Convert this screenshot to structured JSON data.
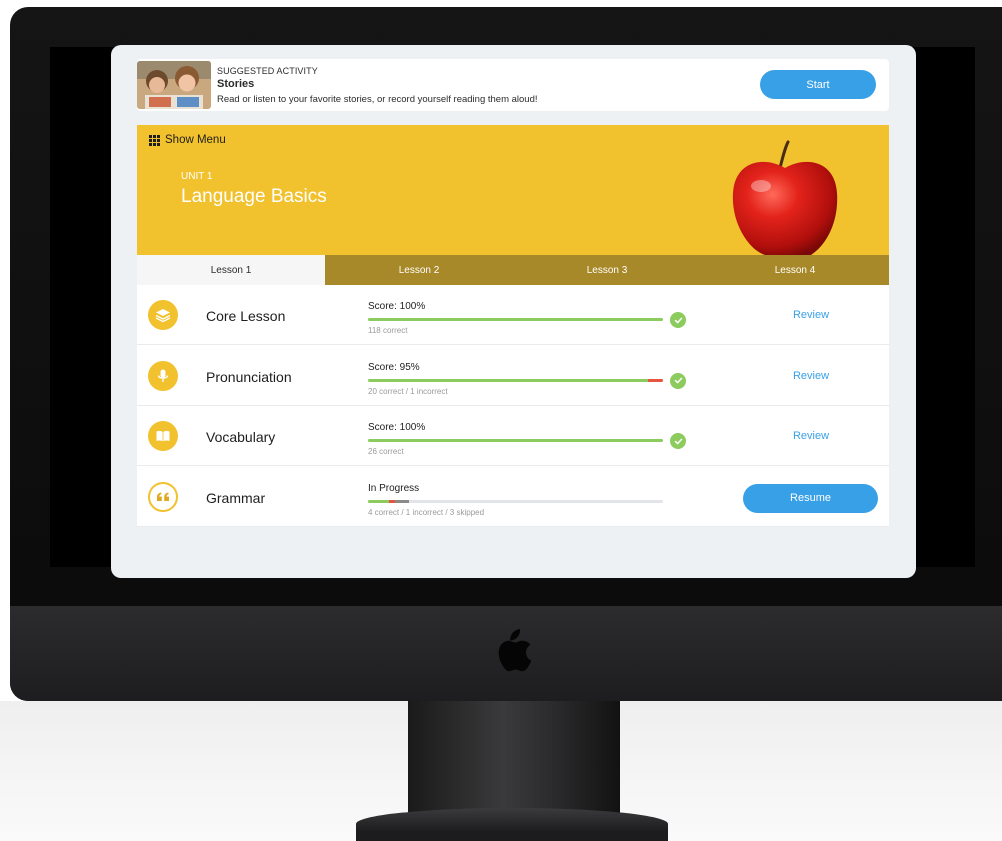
{
  "suggested": {
    "kicker": "SUGGESTED ACTIVITY",
    "title": "Stories",
    "description": "Read or listen to your favorite stories, or record yourself reading them aloud!",
    "start_label": "Start"
  },
  "unit": {
    "menu_label": "Show Menu",
    "label": "UNIT 1",
    "title": "Language Basics"
  },
  "lessons": [
    {
      "label": "Lesson 1",
      "active": true
    },
    {
      "label": "Lesson 2",
      "active": false
    },
    {
      "label": "Lesson 3",
      "active": false
    },
    {
      "label": "Lesson 4",
      "active": false
    }
  ],
  "activities": [
    {
      "name": "Core Lesson",
      "icon": "layers-icon",
      "score_label": "Score: 100%",
      "detail": "118 correct",
      "progress": {
        "correct": 1.0,
        "incorrect": 0.0,
        "skipped": 0.0
      },
      "action": "Review",
      "completed": true
    },
    {
      "name": "Pronunciation",
      "icon": "microphone-icon",
      "score_label": "Score: 95%",
      "detail": "20 correct / 1 incorrect",
      "progress": {
        "correct": 0.95,
        "incorrect": 0.05,
        "skipped": 0.0
      },
      "action": "Review",
      "completed": true
    },
    {
      "name": "Vocabulary",
      "icon": "book-icon",
      "score_label": "Score: 100%",
      "detail": "26 correct",
      "progress": {
        "correct": 1.0,
        "incorrect": 0.0,
        "skipped": 0.0
      },
      "action": "Review",
      "completed": true
    },
    {
      "name": "Grammar",
      "icon": "quote-icon",
      "score_label": "In Progress",
      "detail": "4 correct / 1 incorrect / 3 skipped",
      "progress": {
        "correct": 0.07,
        "incorrect": 0.02,
        "skipped": 0.05
      },
      "action": "Resume",
      "completed": false
    }
  ],
  "colors": {
    "accent_blue": "#38a0e6",
    "unit_yellow": "#f2c12e",
    "tab_bar": "#a8892a",
    "progress_green": "#8ccb5e",
    "progress_red": "#e8553e",
    "progress_skipped": "#8a8a8a"
  }
}
